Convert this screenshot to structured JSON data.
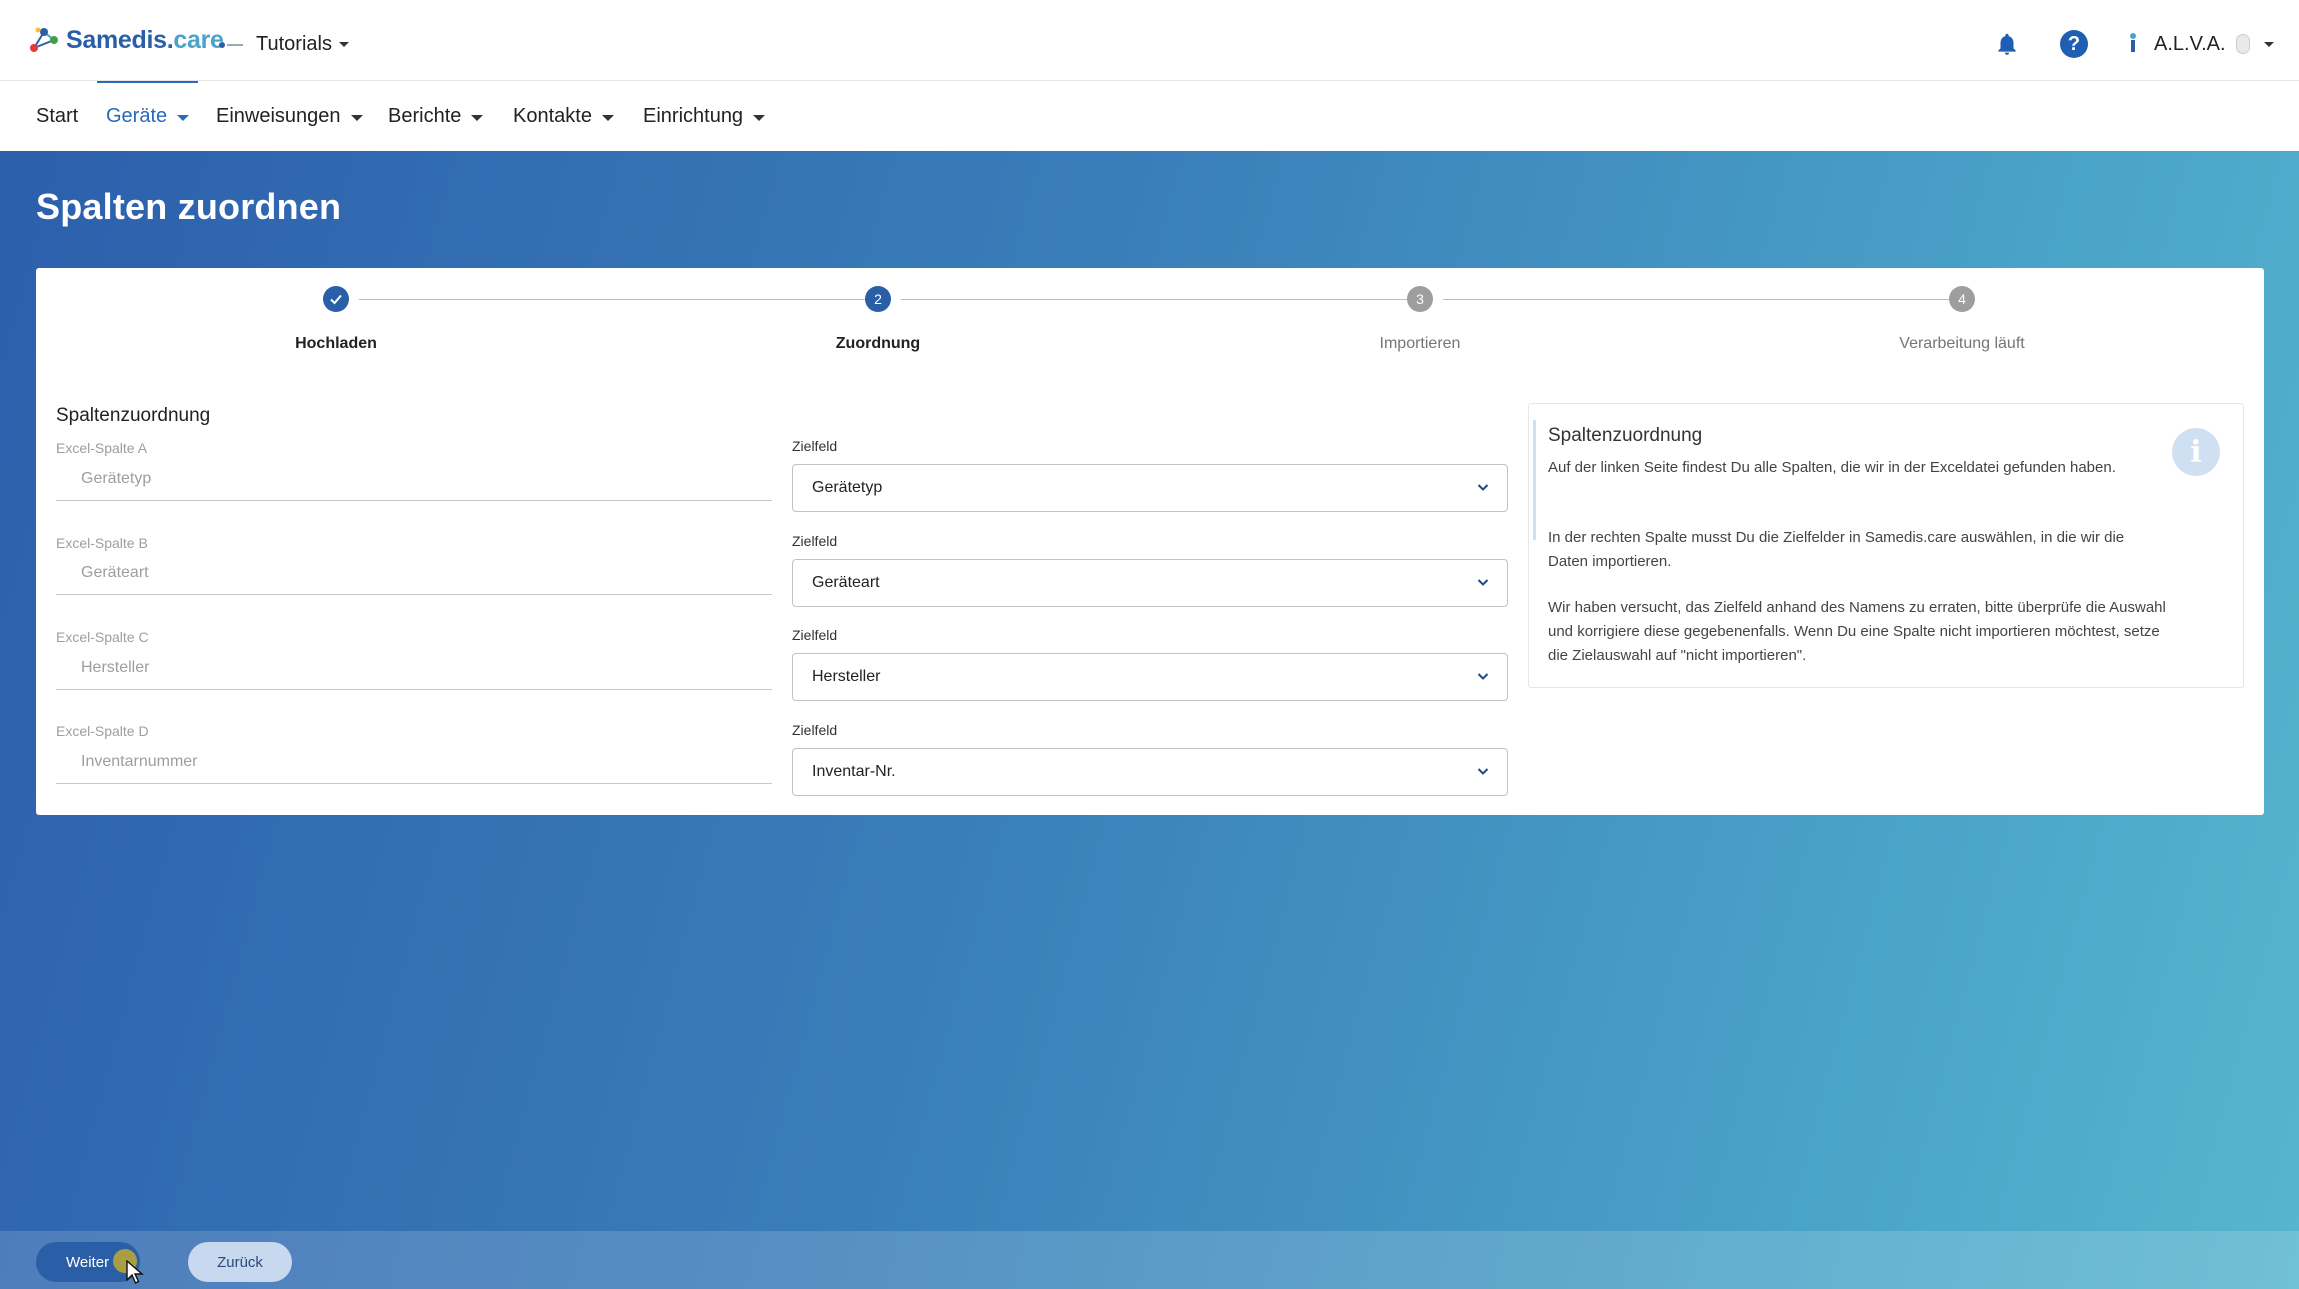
{
  "app": {
    "logo_main": "Samedis.",
    "logo_suffix": "care"
  },
  "header": {
    "tenant": "Tutorials",
    "user": "A.L.V.A."
  },
  "nav": {
    "items": [
      {
        "label": "Start"
      },
      {
        "label": "Geräte"
      },
      {
        "label": "Einweisungen"
      },
      {
        "label": "Berichte"
      },
      {
        "label": "Kontakte"
      },
      {
        "label": "Einrichtung"
      }
    ],
    "active": "Geräte"
  },
  "page": {
    "title": "Spalten zuordnen"
  },
  "stepper": {
    "steps": [
      {
        "label": "Hochladen",
        "status": "done"
      },
      {
        "label": "Zuordnung",
        "number": "2",
        "status": "current"
      },
      {
        "label": "Importieren",
        "number": "3",
        "status": "pending"
      },
      {
        "label": "Verarbeitung läuft",
        "number": "4",
        "status": "pending"
      }
    ]
  },
  "mapping": {
    "section_title": "Spaltenzuordnung",
    "target_label": "Zielfeld",
    "rows": [
      {
        "excel_label": "Excel-Spalte A",
        "excel_value": "Gerätetyp",
        "target_value": "Gerätetyp"
      },
      {
        "excel_label": "Excel-Spalte B",
        "excel_value": "Geräteart",
        "target_value": "Geräteart"
      },
      {
        "excel_label": "Excel-Spalte C",
        "excel_value": "Hersteller",
        "target_value": "Hersteller"
      },
      {
        "excel_label": "Excel-Spalte D",
        "excel_value": "Inventarnummer",
        "target_value": "Inventar-Nr."
      }
    ]
  },
  "info": {
    "title": "Spaltenzuordnung",
    "icon": "i",
    "paragraphs": [
      "Auf der linken Seite findest Du alle Spalten, die wir in der Exceldatei gefunden haben.",
      "In der rechten Spalte musst Du die Zielfelder in Samedis.care auswählen, in die wir die Daten importieren.",
      "Wir haben versucht, das Zielfeld anhand des Namens zu erraten, bitte überprüfe die Auswahl und korrigiere diese gegebenenfalls. Wenn Du eine Spalte nicht importieren möchtest, setze die Zielauswahl auf \"nicht importieren\"."
    ]
  },
  "footer": {
    "next_label": "Weiter",
    "back_label": "Zurück"
  },
  "colors": {
    "primary": "#2a5fa8",
    "accent": "#4aa3c9",
    "pending": "#9e9e9e"
  }
}
